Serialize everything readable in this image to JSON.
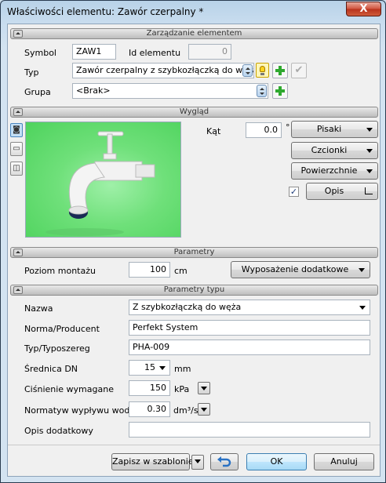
{
  "window": {
    "title": "Właściwości elementu: Zawór czerpalny *",
    "close_label": "X"
  },
  "sections": {
    "management": "Zarządzanie elementem",
    "appearance": "Wygląd",
    "parameters": "Parametry",
    "type_parameters": "Parametry typu"
  },
  "management": {
    "symbol_label": "Symbol",
    "symbol_value": "ZAW1",
    "id_label": "Id elementu",
    "id_value": "0",
    "type_label": "Typ",
    "type_value": "Zawór czerpalny z szybkozłączką do węża/",
    "group_label": "Grupa",
    "group_value": "<Brak>"
  },
  "appearance": {
    "angle_label": "Kąt",
    "angle_value": "0.0",
    "angle_unit": "°",
    "pens_label": "Pisaki",
    "fonts_label": "Czcionki",
    "surfaces_label": "Powierzchnie",
    "description_label": "Opis",
    "description_checked": true
  },
  "parameters": {
    "mount_label": "Poziom montażu",
    "mount_value": "100",
    "mount_unit": "cm",
    "equipment_label": "Wyposażenie dodatkowe"
  },
  "type_parameters": {
    "name_label": "Nazwa",
    "name_value": "Z szybkozłączką do węża",
    "norm_label": "Norma/Producent",
    "norm_value": "Perfekt System",
    "typeseries_label": "Typ/Typoszereg",
    "typeseries_value": "PHA-009",
    "dn_label": "Średnica DN",
    "dn_value": "15",
    "dn_unit": "mm",
    "pressure_label": "Ciśnienie wymagane",
    "pressure_value": "150",
    "pressure_unit": "kPa",
    "flow_label": "Normatyw wypływu wody",
    "flow_value": "0.30",
    "flow_unit": "dm³/s",
    "extra_label": "Opis dodatkowy",
    "extra_value": ""
  },
  "footer": {
    "save_template_label": "Zapisz w szablonie",
    "ok_label": "OK",
    "cancel_label": "Anuluj"
  },
  "colors": {
    "preview_background": "#6fe07a",
    "ok_accent": "#3c7fb1",
    "add_icon": "#2fa82f"
  }
}
